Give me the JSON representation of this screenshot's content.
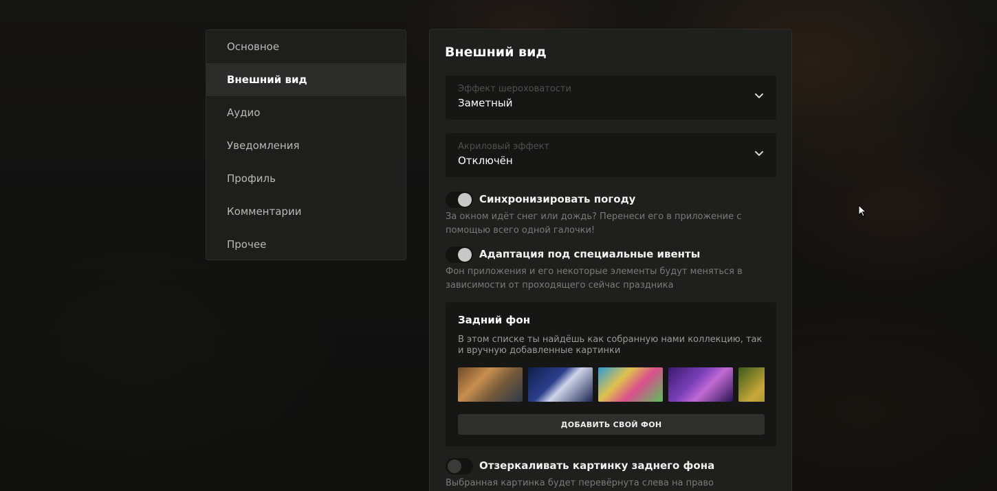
{
  "sidebar": {
    "items": [
      {
        "label": "Основное"
      },
      {
        "label": "Внешний вид"
      },
      {
        "label": "Аудио"
      },
      {
        "label": "Уведомления"
      },
      {
        "label": "Профиль"
      },
      {
        "label": "Комментарии"
      },
      {
        "label": "Прочее"
      }
    ],
    "active_index": 1
  },
  "main": {
    "title": "Внешний вид",
    "roughness_select": {
      "label": "Эффект шероховатости",
      "value": "Заметный"
    },
    "acrylic_select": {
      "label": "Акриловый эффект",
      "value": "Отключён"
    },
    "toggles": [
      {
        "title": "Синхронизировать погоду",
        "description": "За окном идёт снег или дождь? Перенеси его в приложение с помощью всего одной галочки!",
        "state": "on"
      },
      {
        "title": "Адаптация под специальные ивенты",
        "description": "Фон приложения и его некоторые элементы будут меняться в зависимости от проходящего сейчас праздника",
        "state": "on"
      },
      {
        "title": "Отзеркаливать картинку заднего фона",
        "description": "Выбранная картинка будет перевёрнута слева на право",
        "state": "off"
      }
    ],
    "background_card": {
      "title": "Задний фон",
      "description": "В этом списке ты найдёшь как собранную нами коллекцию, так и вручную добавленные картинки",
      "add_button_label": "ДОБАВИТЬ СВОЙ ФОН"
    }
  }
}
